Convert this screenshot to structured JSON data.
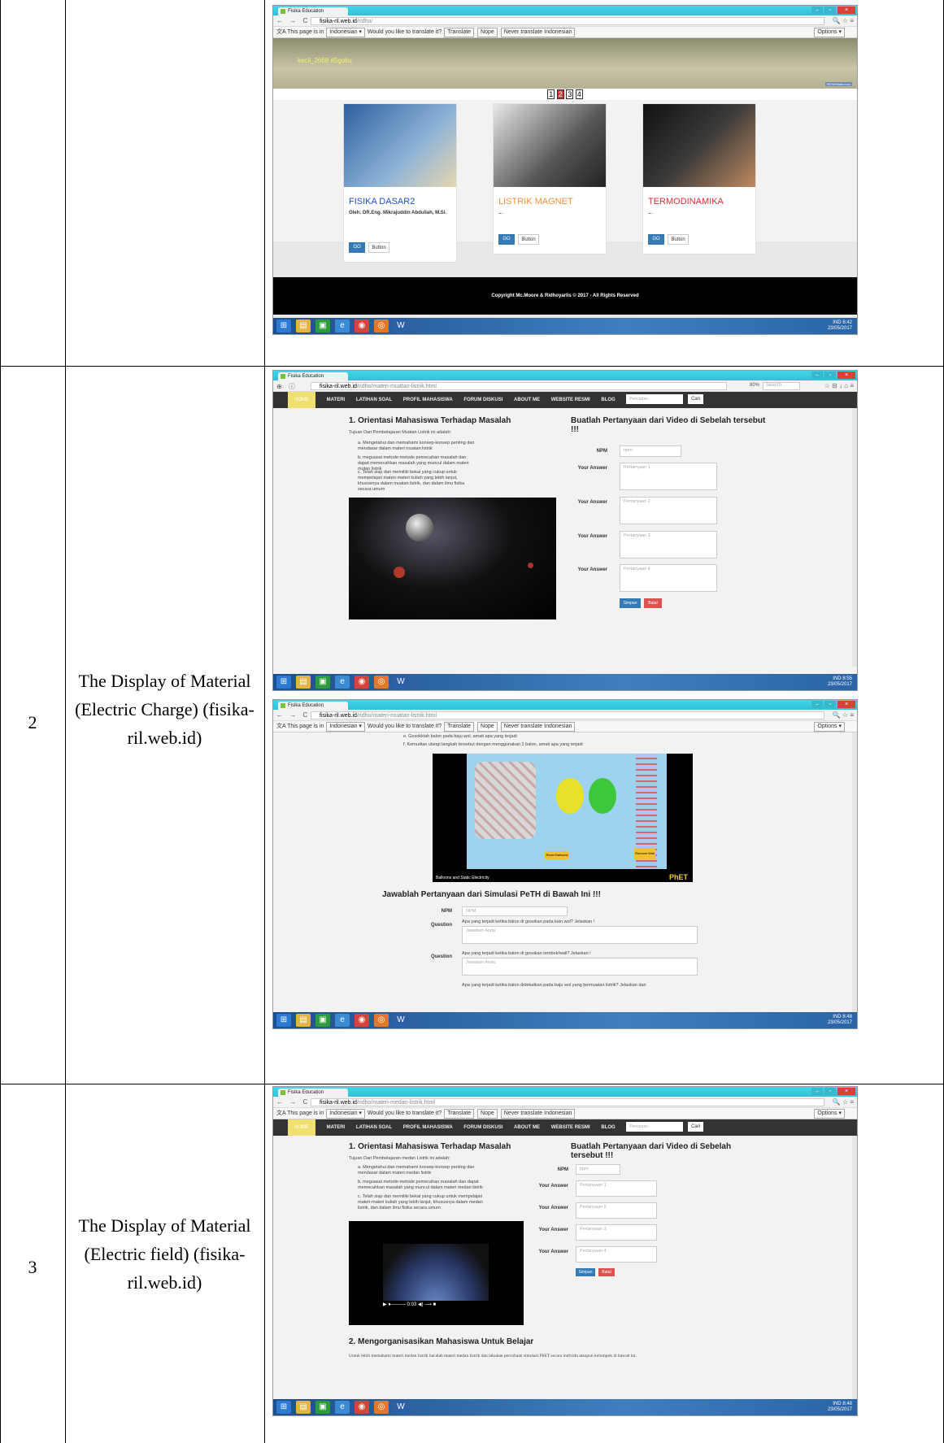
{
  "table": {
    "rows": [
      {
        "num": "",
        "label": ""
      },
      {
        "num": "2",
        "label": "The Display of Material (Electric Charge) (fisika-ril.web.id)"
      },
      {
        "num": "3",
        "label": "The Display of Material (Electric field) (fisika-ril.web.id)"
      }
    ]
  },
  "browser": {
    "tab_title": "Fisika Education",
    "translate_msg_pre": "This page is in",
    "translate_lang": "Indonesian ▾",
    "translate_question": "Would you like to translate it?",
    "translate_btn": "Translate",
    "nope_btn": "Nope",
    "never_btn": "Never translate Indonesian",
    "options_btn": "Options ▾"
  },
  "shot1": {
    "url_host": "fisika-ril.web.id",
    "url_path": "/ridho/",
    "slider_caption": "kecil_2668 #5goku",
    "slider_credit": "WOWSlider.com",
    "pages": [
      "1",
      "2",
      "3",
      "4"
    ],
    "cards": [
      {
        "title": "FISIKA DASAR2",
        "by": "Oleh: DR.Eng. Mikrajuddin Abdullah, M.Si.",
        "go": "GO",
        "btn": "Button",
        "color": "#1f4fcf"
      },
      {
        "title": "LISTRIK MAGNET",
        "by": "...",
        "go": "GO",
        "btn": "Button",
        "color": "#f0923a"
      },
      {
        "title": "TERMODINAMIKA",
        "by": "...",
        "go": "GO",
        "btn": "Button",
        "color": "#d9303a"
      }
    ],
    "footer": "Copyright Mc.Moore & Ridhoyarlis © 2017 - All Rights Reserved",
    "clock": "8:42",
    "date": "23/05/2017"
  },
  "shot2": {
    "url_host": "fisika-ril.web.id",
    "url_path": "/ridho/materi-muatan-listrik.html",
    "zoom": "80%",
    "search_ph": "Search",
    "nav": [
      "HOME",
      "MATERI",
      "LATIHAN SOAL",
      "PROFIL MAHASISWA",
      "FORUM DISKUSI",
      "ABOUT ME",
      "WEBSITE RESMI",
      "BLOG"
    ],
    "nav_search": "Pencarian...",
    "nav_cari": "Cari",
    "heading_left": "1. Orientasi Mahasiswa Terhadap Masalah",
    "intro": "Tujuan Dari Pembelajaran Muatan Listrik ini adalah:",
    "items": [
      "a.  Mengetahui dan memahami konsep-konsep penting dan mendasar dalam materi muatan listrik",
      "b.  meguasai metode-metode pemecahan masalah dan dapat memecahkan masalah yang muncul dalam materi mutan listrik",
      "c.  Telah siap dan memiliki bekal yang cukup untuk mempelajari materi-materi kuliah yang lebih lanjut, khususnya dalam muatan listrik, dan dalam ilmu fisika secara umum"
    ],
    "heading_right": "Buatlah Pertanyaan dari Video di Sebelah tersebut !!!",
    "npm_label": "NPM",
    "npm_ph": "npm",
    "answer_label": "Your Answer",
    "answers": [
      "Pertanyaan 1",
      "Pertanyaan 2",
      "Pertanyaan 3",
      "Pertanyaan 4"
    ],
    "simpan": "Simpan",
    "batal": "Batal",
    "clock": "8:55",
    "date": "23/05/2017"
  },
  "shot3": {
    "url_host": "fisika-ril.web.id",
    "url_path": "/ridho/materi-muatan-listrik.html",
    "steps": [
      "e.  Gosokklah balon pada baju wol, amati apa yang terjadi",
      "f.   Kemudian ulangi langkah tersebut dengan menggunakan 2 balon, amati apa yang terjadi"
    ],
    "sim_caption": "Balloons and Static Electricity",
    "sim_brand": "PhET",
    "sim_reset": "Reset Balloons",
    "sim_remove": "Remove Wall",
    "heading": "Jawablah Pertanyaan dari Simulasi PeTH di Bawah Ini !!!",
    "npm_label": "NPM",
    "npm_ph": "NPM",
    "question_label": "Question",
    "questions": [
      "Apa yang terjadi ketika balon di gosokan pada kain wol? Jelaskan !",
      "Apa yang terjadi ketika balon di gosokan tembok/wall? Jelaskan !",
      "Apa yang terjadi ketika balon didekatkan pada baju wol yang bermuatan listrik? Jelaskan dan"
    ],
    "answer_ph": "Jawaban Anda",
    "clock": "8:48",
    "date": "23/05/2017"
  },
  "shot4": {
    "url_host": "fisika-ril.web.id",
    "url_path": "/ridho/materi-medan-listrik.html",
    "nav": [
      "HOME",
      "MATERI",
      "LATIHAN SOAL",
      "PROFIL MAHASISWA",
      "FORUM DISKUSI",
      "ABOUT ME",
      "WEBSITE RESMI",
      "BLOG"
    ],
    "nav_search": "Pencarian...",
    "nav_cari": "Cari",
    "heading_left": "1. Orientasi Mahasiswa Terhadap Masalah",
    "intro": "Tujuan Dari Pembelajaran medan Listrik ini adalah:",
    "items": [
      "a.  Mengetahui dan memahami konsep-konsep penting dan mendasar dalam materi medan listrik",
      "b.  meguasai metode-metode pemecahan masalah dan dapat memecahkan masalah yang muncul dalam materi medan listrik",
      "c.  Telah siap dan memiliki bekal yang cukup untuk mempelajari materi-materi kuliah yang lebih lanjut, khususnya dalam medan listrik, dan dalam ilmu fisika secara umum"
    ],
    "heading_right": "Buatlah Pertanyaan dari Video di Sebelah tersebut !!!",
    "npm_label": "NPM",
    "npm_ph": "npm",
    "answer_label": "Your Answer",
    "answers": [
      "Pertanyaan 1",
      "Pertanyaan 2",
      "Pertanyaan 3",
      "Pertanyaan 4"
    ],
    "simpan": "Simpan",
    "batal": "Batal",
    "video_time": "0:03",
    "heading2": "2. Mengorganisasikan Mahasiswa Untuk Belajar",
    "para2": "Untuk lebih memahami materi medan listrik bacalah materi medan listrik dan lakukan percobaan simulasi PhET secara individu ataupun kelompok di bawah ini.",
    "clock": "8:48",
    "date": "23/05/2017"
  },
  "taskbar": {
    "lang": "IND"
  }
}
